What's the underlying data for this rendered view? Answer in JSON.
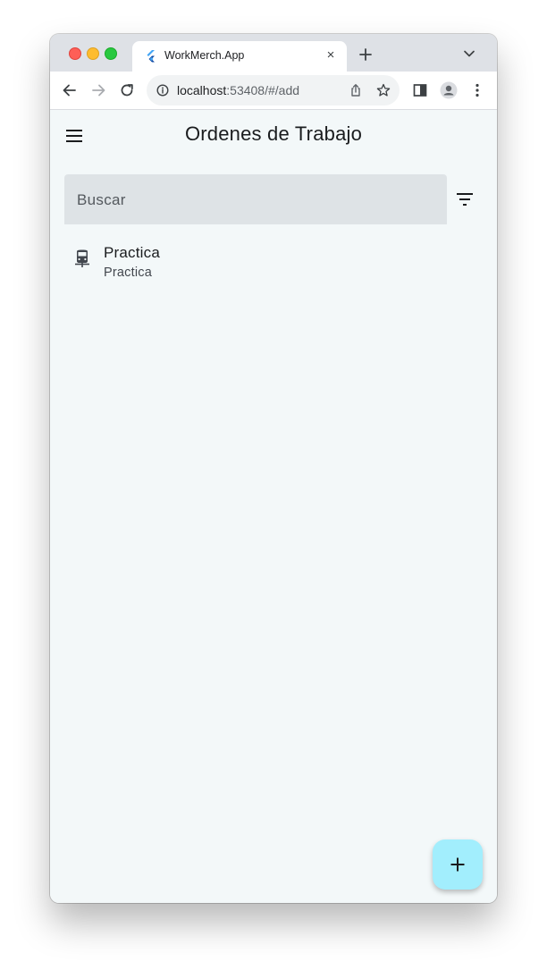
{
  "browser": {
    "tab": {
      "title": "WorkMerch.App",
      "close_glyph": "×",
      "favicon": "flutter-logo-icon"
    },
    "new_tab_icon": "plus-icon",
    "tab_menu_icon": "chevron-down-icon",
    "toolbar": {
      "back_icon": "arrow-left-icon",
      "forward_icon": "arrow-right-icon",
      "reload_icon": "reload-icon",
      "url_host": "localhost",
      "url_rest": ":53408/#/add",
      "info_icon": "info-icon",
      "share_icon": "share-icon",
      "bookmark_icon": "star-icon",
      "sidepanel_icon": "side-panel-icon",
      "profile_icon": "profile-avatar-icon",
      "menu_icon": "more-vert-icon"
    }
  },
  "app": {
    "appbar": {
      "title": "Ordenes de Trabajo",
      "menu_icon": "hamburger-menu-icon"
    },
    "search": {
      "placeholder": "Buscar",
      "value": ""
    },
    "filter_icon": "filter-list-icon",
    "list": [
      {
        "title": "Practica",
        "subtitle": "Practica",
        "icon": "train-icon"
      }
    ],
    "fab": {
      "icon": "plus-icon"
    }
  },
  "colors": {
    "page_background": "#f3f8f9",
    "search_background": "#dee3e6",
    "fab_background": "#a2eefd",
    "tabstrip": "#dee1e6"
  }
}
